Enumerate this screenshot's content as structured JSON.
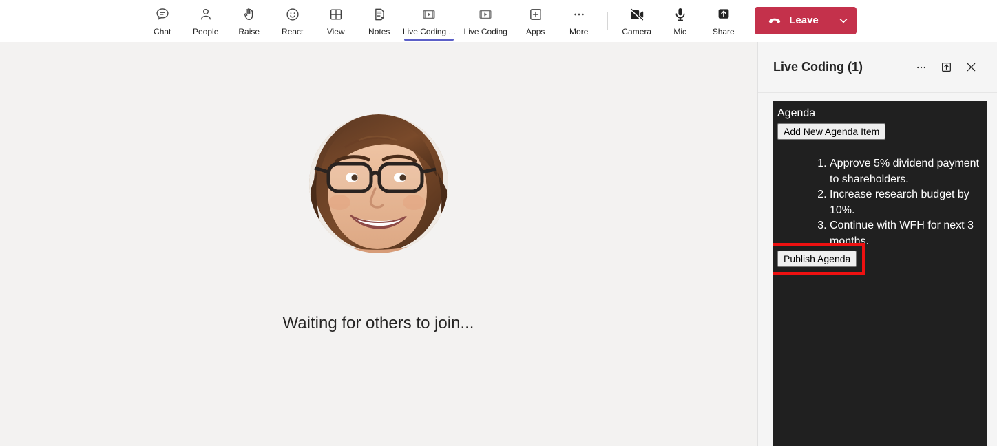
{
  "toolbar": {
    "items": [
      {
        "label": "Chat",
        "icon": "chat-icon",
        "active": false
      },
      {
        "label": "People",
        "icon": "people-icon",
        "active": false
      },
      {
        "label": "Raise",
        "icon": "raise-hand-icon",
        "active": false
      },
      {
        "label": "React",
        "icon": "react-icon",
        "active": false
      },
      {
        "label": "View",
        "icon": "view-grid-icon",
        "active": false
      },
      {
        "label": "Notes",
        "icon": "notes-icon",
        "active": false
      },
      {
        "label": "Live Coding ...",
        "icon": "live-coding-icon",
        "active": true
      },
      {
        "label": "Live Coding",
        "icon": "live-coding-icon",
        "active": false
      },
      {
        "label": "Apps",
        "icon": "apps-plus-icon",
        "active": false
      },
      {
        "label": "More",
        "icon": "more-ellipsis-icon",
        "active": false
      }
    ],
    "device_items": [
      {
        "label": "Camera",
        "icon": "camera-off-icon",
        "state": "off"
      },
      {
        "label": "Mic",
        "icon": "mic-icon",
        "state": "on"
      },
      {
        "label": "Share",
        "icon": "share-up-icon",
        "state": "on"
      }
    ],
    "leave": {
      "label": "Leave",
      "icon": "hangup-icon",
      "caret_icon": "chevron-down-icon",
      "color": "#c4314b"
    },
    "active_underline_color": "#5b5fc7"
  },
  "stage": {
    "avatar_name": "participant-avatar",
    "waiting_text": "Waiting for others to join..."
  },
  "side_panel": {
    "title": "Live Coding (1)",
    "actions": [
      {
        "name": "more-options-icon",
        "icon": "more-ellipsis-icon"
      },
      {
        "name": "popout-icon",
        "icon": "popout-arrow-icon"
      },
      {
        "name": "close-icon",
        "icon": "close-x-icon"
      }
    ],
    "app": {
      "heading": "Agenda",
      "add_button_label": "Add New Agenda Item",
      "agenda_items": [
        "Approve 5% dividend payment to shareholders.",
        "Increase research budget by 10%.",
        "Continue with WFH for next 3 months."
      ],
      "publish_button_label": "Publish Agenda",
      "highlight_color": "#ee1111",
      "background_color": "#202020"
    }
  }
}
